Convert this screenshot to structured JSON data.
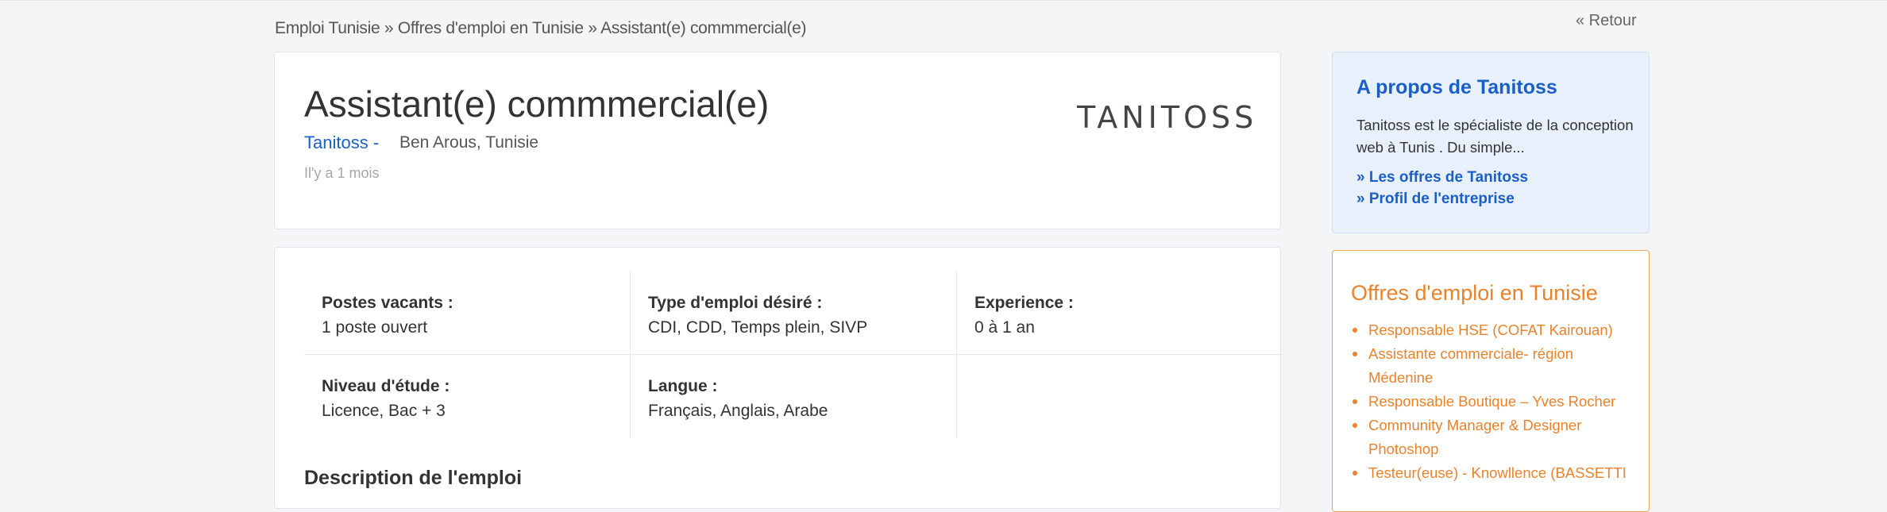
{
  "breadcrumb": {
    "items": [
      "Emploi Tunisie",
      "Offres d'emploi en Tunisie",
      "Assistant(e) commmercial(e)"
    ],
    "separator": "»"
  },
  "back_label": "« Retour",
  "job": {
    "title": "Assistant(e) commmercial(e)",
    "company_link": "Tanitoss -",
    "location": "Ben Arous, Tunisie",
    "posted": "Il'y a 1 mois",
    "logo_text": "TANITOSS"
  },
  "details": {
    "postes_label": "Postes vacants :",
    "postes_value": "1 poste ouvert",
    "type_label": "Type d'emploi désiré :",
    "type_value": "CDI, CDD, Temps plein, SIVP",
    "experience_label": "Experience :",
    "experience_value": "0 à 1 an",
    "niveau_label": "Niveau d'étude :",
    "niveau_value": "Licence, Bac + 3",
    "langue_label": "Langue :",
    "langue_value": "Français, Anglais, Arabe"
  },
  "description_title": "Description de l'emploi",
  "about": {
    "title": "A propos de Tanitoss",
    "text": "Tanitoss est le spécialiste de la conception web à Tunis . Du simple...",
    "link_offers": "» Les offres de Tanitoss",
    "link_profile": "» Profil de l'entreprise"
  },
  "offers": {
    "title": "Offres d'emploi en Tunisie",
    "items": [
      "Responsable HSE (COFAT Kairouan)",
      "Assistante commerciale- région Médenine",
      "Responsable Boutique – Yves Rocher",
      "Community Manager & Designer Photoshop",
      "Testeur(euse) - Knowllence (BASSETTI"
    ]
  },
  "colors": {
    "link_blue": "#1a5fc8",
    "accent_orange": "#e8832c",
    "about_bg": "#e8f0fb"
  }
}
